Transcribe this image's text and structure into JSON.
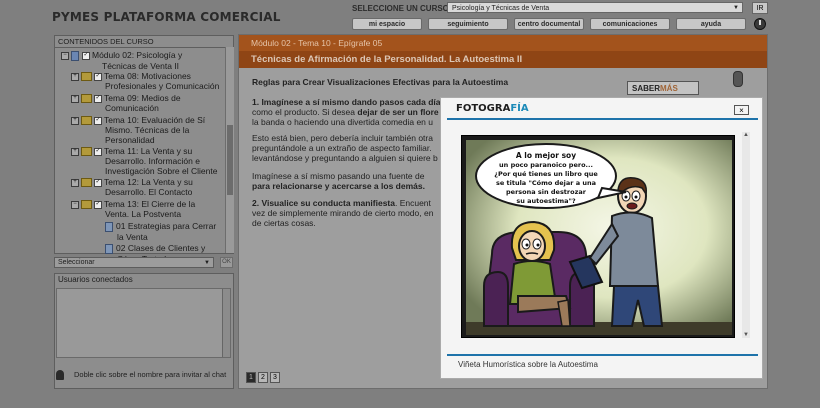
{
  "header": {
    "brand": "PYMES PLATAFORMA COMERCIAL",
    "course_label": "SELECCIONE UN CURSO:",
    "course_value": "Psicología y Técnicas de Venta",
    "ir_label": "IR",
    "nav": [
      "mi espacio",
      "seguimiento",
      "centro documental",
      "comunicaciones",
      "ayuda"
    ]
  },
  "sidebar": {
    "title": "CONTENIDOS DEL CURSO",
    "tree": [
      {
        "icons": [
          "minus",
          "doc",
          "check"
        ],
        "lines": [
          "Módulo 02: Psicología y",
          "Técnicas de Venta II"
        ]
      },
      {
        "icons": [
          "plus",
          "folder",
          "check"
        ],
        "lines": [
          "Tema 08: Motivaciones",
          "Profesionales y Comunicación"
        ]
      },
      {
        "icons": [
          "plus",
          "folder",
          "check"
        ],
        "lines": [
          "Tema 09: Medios de",
          "Comunicación"
        ]
      },
      {
        "icons": [
          "plus",
          "folder",
          "check"
        ],
        "lines": [
          "Tema 10: Evaluación de Sí",
          "Mismo. Técnicas de la",
          "Personalidad"
        ]
      },
      {
        "icons": [
          "plus",
          "folder",
          "check"
        ],
        "lines": [
          "Tema 11: La Venta y su",
          "Desarrollo. Información e",
          "Investigación Sobre el Cliente"
        ]
      },
      {
        "icons": [
          "plus",
          "folder",
          "check"
        ],
        "lines": [
          "Tema 12: La Venta y su",
          "Desarrollo. El Contacto"
        ]
      },
      {
        "icons": [
          "minus",
          "folder",
          "check"
        ],
        "lines": [
          "Tema 13: El Cierre de la",
          "Venta. La Postventa"
        ]
      },
      {
        "icons": [
          "doc"
        ],
        "lines": [
          "01 Estrategias para Cerrar",
          "la Venta"
        ]
      },
      {
        "icons": [
          "doc"
        ],
        "lines": [
          "02 Clases de Clientes y",
          "Cómo Tratarlos"
        ]
      }
    ],
    "select_value": "Seleccionar",
    "ok_label": "OK",
    "users_title": "Usuarios conectados",
    "users_hint": "Doble clic sobre el nombre para invitar al chat"
  },
  "main": {
    "breadcrumb": "Módulo 02 - Tema 10 - Epígrafe 05",
    "title": "Técnicas de Afirmación de la Personalidad. La Autoestima II",
    "subtitle": "Reglas para Crear Visualizaciones Efectivas para la Autoestima",
    "p1": [
      {
        "t": "1. Imagínese a sí mismo ",
        "b": true
      },
      {
        "t": "dando pasos cada día",
        "b": true
      }
    ],
    "p1_line2": "como el producto. Si desea ",
    "p1_line2_b": "dejar de ser un flore",
    "p1_line3": "la banda o haciendo una divertida comedia en u",
    "p2_line1": "Esto está bien, pero debería incluir también otra",
    "p2_line2": "preguntándole a un extraño de aspecto familiar.",
    "p2_line3": "levantándose y preguntando a alguien si quiere b",
    "p3_line1": "Imagínese a sí mismo pasando una fuente de",
    "p3_line2": "para relacionarse y acercarse a los demás.",
    "p4_line1a": "2. Visualice su conducta manifiesta",
    "p4_line1b": ". Encuent",
    "p4_line2": "vez de simplemente mirando de cierto modo, en",
    "p4_line3": "de ciertas cosas.",
    "saber_a": "SABER",
    "saber_b": "MÁS",
    "pages": [
      "1",
      "2",
      "3"
    ]
  },
  "modal": {
    "logo_a": "FOTOGRA",
    "logo_b": "FÍA",
    "close_label": "×",
    "bubble": [
      "A lo mejor soy",
      "un poco paranoico pero...",
      "¿Por qué tienes un libro que",
      "se titula  \"Cómo dejar a una",
      "persona sin destrozar",
      "su autoestima\"?"
    ],
    "caption": "Viñeta Humorística sobre la Autoestima"
  }
}
